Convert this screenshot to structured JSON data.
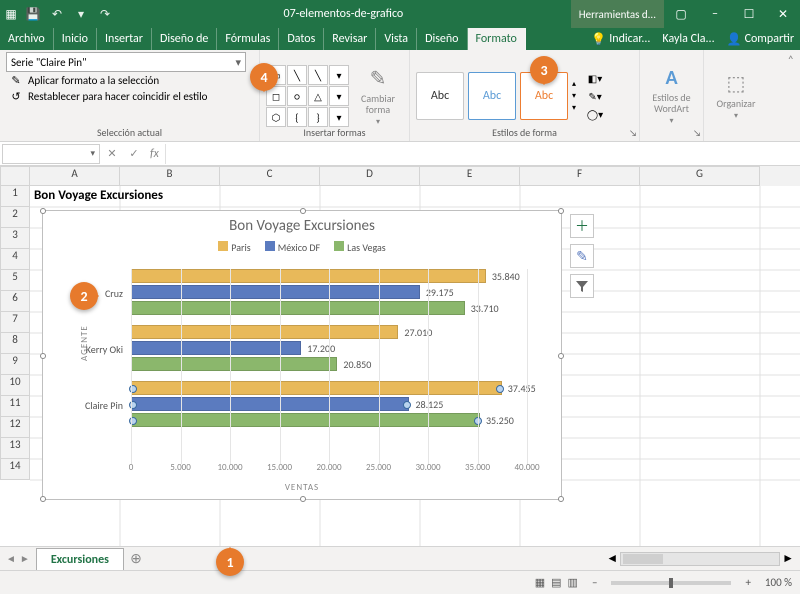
{
  "titlebar": {
    "app_icon": "⊞",
    "quick": {
      "save": "💾",
      "undo": "↶",
      "undo_drop": "▾",
      "redo": "↷"
    },
    "docname": "07-elementos-de-grafico",
    "tools_context": "Herramientas d...",
    "win": {
      "min": "–",
      "max": "☐",
      "close": "✕",
      "ribbon": "▢"
    }
  },
  "menu": {
    "items": [
      "Archivo",
      "Inicio",
      "Insertar",
      "Diseño de",
      "Fórmulas",
      "Datos",
      "Revisar",
      "Vista",
      "Diseño",
      "Formato"
    ],
    "active_index": 9,
    "tell_me": "Indicar...",
    "user": "Kayla Cla...",
    "share": "Compartir"
  },
  "ribbon": {
    "group0": {
      "label": "Selección actual",
      "dropdown_value": "Serie \"Claire Pin\"",
      "btn_format": "Aplicar formato a la selección",
      "btn_reset": "Restablecer para hacer coincidir el estilo"
    },
    "group1": {
      "label": "Insertar formas",
      "change": "Cambiar forma"
    },
    "group2": {
      "label": "Estilos de forma",
      "sample": "Abc"
    },
    "group3": {
      "label": "Estilos de WordArt"
    },
    "group4": {
      "label": "Organizar"
    }
  },
  "namebox": "",
  "cell_a1": "Bon Voyage Excursiones",
  "chart": {
    "title": "Bon Voyage Excursiones",
    "legend": [
      "Paris",
      "México DF",
      "Las Vegas"
    ],
    "yaxis": "AGENTE",
    "xaxis": "VENTAS",
    "xmax": 40000,
    "ticks": [
      "0",
      "5.000",
      "10.000",
      "15.000",
      "20.000",
      "25.000",
      "30.000",
      "35.000",
      "40.000"
    ],
    "colors": {
      "Paris": "#e8b95a",
      "México DF": "#5b7bbf",
      "Las Vegas": "#8bb76c"
    },
    "side_btns": {
      "plus": "＋",
      "brush": "✎",
      "filter": "▾"
    }
  },
  "chart_data": {
    "type": "bar",
    "orientation": "horizontal",
    "title": "Bon Voyage Excursiones",
    "xlabel": "VENTAS",
    "ylabel": "AGENTE",
    "xlim": [
      0,
      40000
    ],
    "categories": [
      "Cruz",
      "Kerry Oki",
      "Claire Pin"
    ],
    "series": [
      {
        "name": "Paris",
        "values": [
          35840,
          27010,
          37455
        ]
      },
      {
        "name": "México DF",
        "values": [
          29175,
          17200,
          28125
        ]
      },
      {
        "name": "Las Vegas",
        "values": [
          33710,
          20850,
          35250
        ]
      }
    ],
    "value_labels": {
      "Cruz": [
        "35.840",
        "29.175",
        "33.710"
      ],
      "Kerry Oki": [
        "27.010",
        "17.200",
        "20.850"
      ],
      "Claire Pin": [
        "37.455",
        "28.125",
        "35.250"
      ]
    },
    "selected_series": "Claire Pin"
  },
  "sheet": {
    "active_tab": "Excursiones"
  },
  "status": {
    "zoom": "100 %"
  },
  "callouts": {
    "1": "1",
    "2": "2",
    "3": "3",
    "4": "4"
  }
}
